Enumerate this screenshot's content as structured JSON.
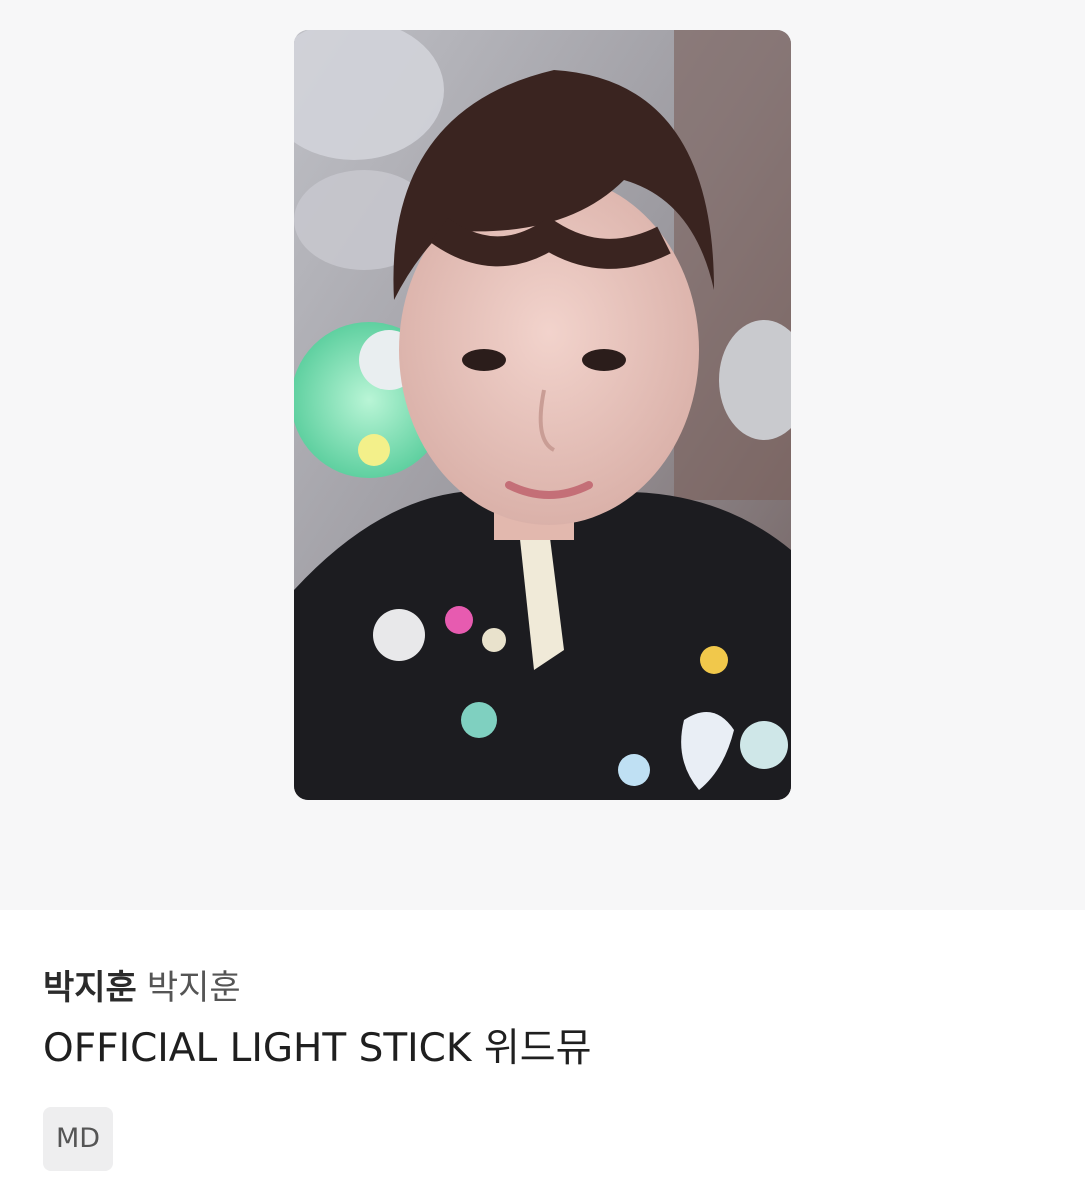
{
  "product": {
    "image_alt": "박지훈 OFFICIAL LIGHT STICK 위드뮤 photocard",
    "artist_primary": "박지훈",
    "artist_secondary": "박지훈",
    "title": "OFFICIAL LIGHT STICK 위드뮤",
    "category_badge": "MD"
  },
  "colors": {
    "image_bg": "#f7f7f8",
    "badge_bg": "#eeeeef",
    "text_primary": "#1f1f1f",
    "text_secondary": "#555555"
  }
}
